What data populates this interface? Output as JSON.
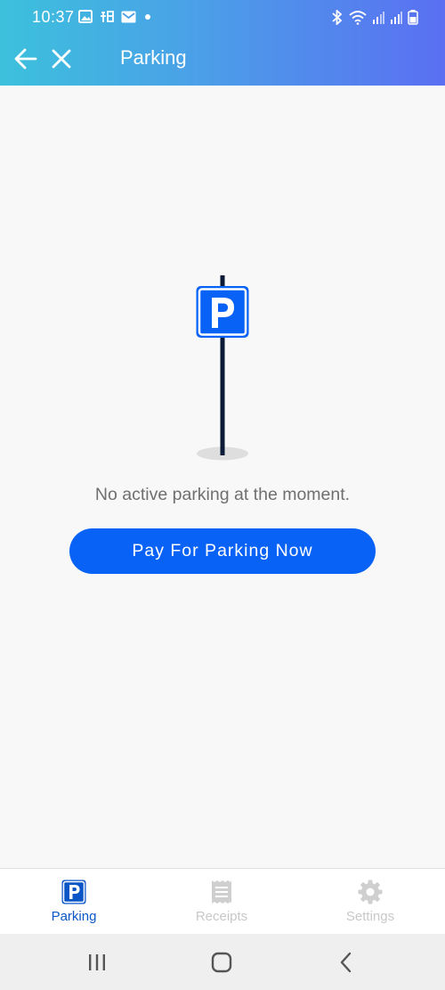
{
  "status_bar": {
    "time": "10:37",
    "left_icons": [
      "image-icon",
      "taobao-icon",
      "mail-icon",
      "dot-icon"
    ],
    "right_icons": [
      "bluetooth-icon",
      "wifi-icon",
      "signal-icon",
      "signal-icon",
      "battery-icon"
    ]
  },
  "app_bar": {
    "title": "Parking",
    "back_icon": "arrow-left-icon",
    "close_icon": "close-icon"
  },
  "main": {
    "illustration": "parking-sign-icon",
    "empty_message": "No active parking at the moment.",
    "pay_button_label": "Pay For Parking Now"
  },
  "bottom_nav": {
    "items": [
      {
        "label": "Parking",
        "icon": "parking-icon",
        "active": true
      },
      {
        "label": "Receipts",
        "icon": "receipt-icon",
        "active": false
      },
      {
        "label": "Settings",
        "icon": "gear-icon",
        "active": false
      }
    ]
  },
  "system_nav": {
    "buttons": [
      "recent-apps-icon",
      "home-icon",
      "back-icon"
    ]
  },
  "colors": {
    "header_gradient_start": "#3cc1dc",
    "header_gradient_end": "#5a6ff2",
    "primary_button": "#0862f6",
    "active_nav": "#0b56c7",
    "inactive_nav": "#c8c8c8"
  }
}
